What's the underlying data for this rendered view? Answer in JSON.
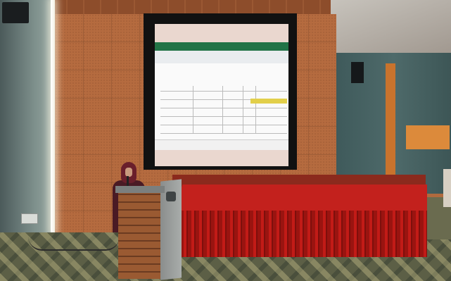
{
  "scene": {
    "kind": "auditorium stage with projection screen showing a spreadsheet",
    "colors": {
      "wall_wood": "#b56b3f",
      "stage_red": "#c3211d",
      "spreadsheet_green": "#217346",
      "floor": "#5c5f46"
    }
  }
}
